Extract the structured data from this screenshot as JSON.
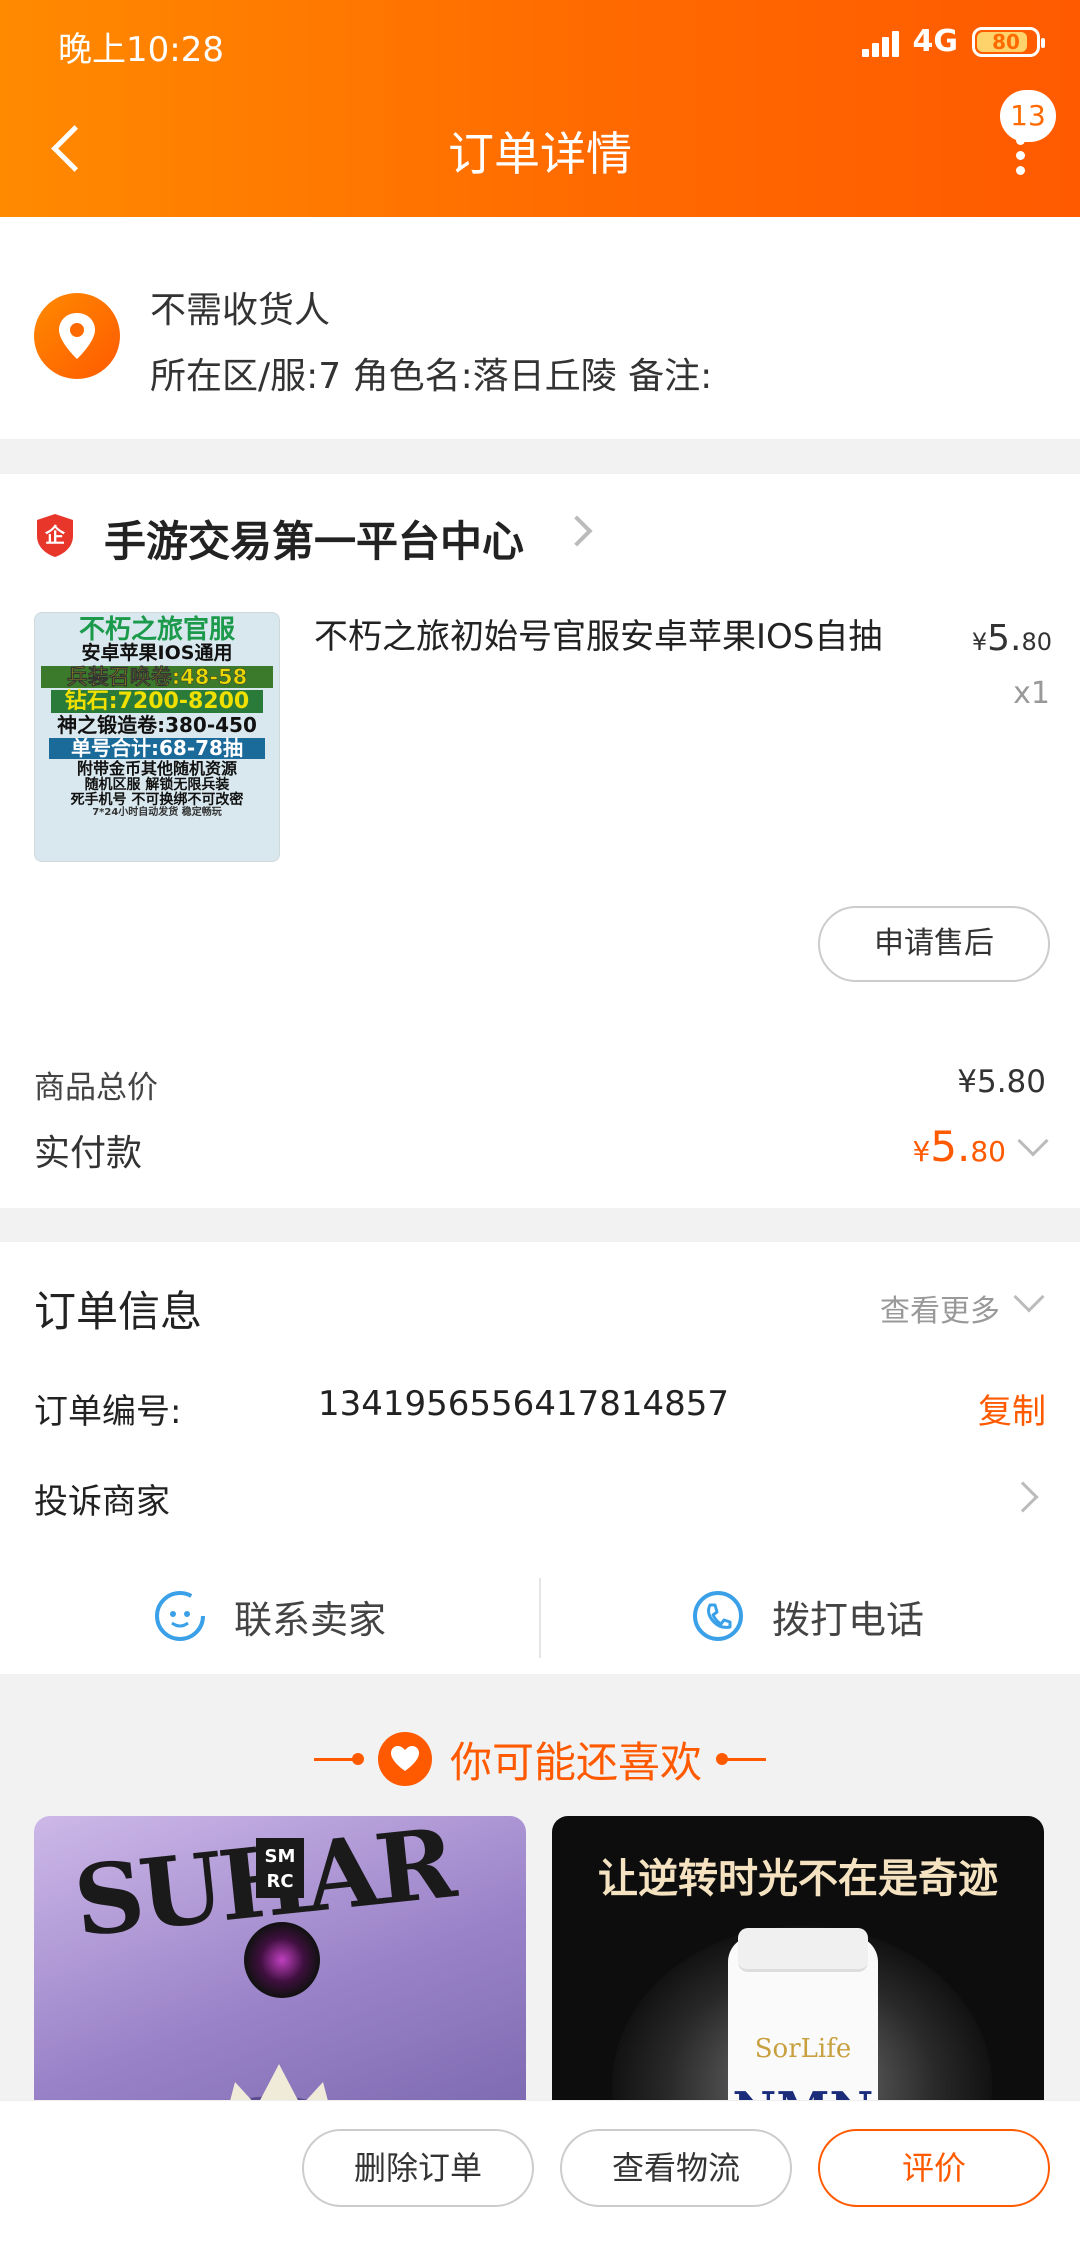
{
  "status_bar": {
    "time": "晚上10:28",
    "network": "4G",
    "battery": "80"
  },
  "nav": {
    "title": "订单详情",
    "badge_count": "13"
  },
  "address": {
    "line1": "不需收货人",
    "line2": "所在区/服:7 角色名:落日丘陵 备注:"
  },
  "shop": {
    "name": "手游交易第一平台中心",
    "product": {
      "title": "不朽之旅初始号官服安卓苹果IOS自抽",
      "price_symbol": "¥",
      "price_int": "5.",
      "price_dec": "80",
      "qty": "x1",
      "image_lines": [
        "不朽之旅官服",
        "安卓苹果IOS通用",
        "兵装召唤卷:48-58",
        "钻石:7200-8200",
        "神之锻造卷:380-450",
        "单号合计:68-78抽",
        "附带金币其他随机资源",
        "随机区服 解锁无限兵装",
        "死手机号 不可换绑不可改密",
        "7*24小时自动发货 稳定畅玩"
      ]
    },
    "after_sale_label": "申请售后",
    "total_label": "商品总价",
    "total_value": "¥5.80",
    "pay_label": "实付款",
    "pay_symbol": "¥",
    "pay_int": "5.",
    "pay_dec": "80"
  },
  "order_info": {
    "title": "订单信息",
    "more_label": "查看更多",
    "number_label": "订单编号:",
    "number_value": "1341956556417814857",
    "copy_label": "复制",
    "complain_label": "投诉商家",
    "contact_seller": "联系卖家",
    "call_phone": "拨打电话"
  },
  "recommend": {
    "title": "你可能还喜欢",
    "card_a": {
      "big_text": "SUHAR",
      "logo_text": "SM RC"
    },
    "card_b": {
      "headline": "让逆转时光不在是奇迹",
      "brand": "SorLife",
      "product": "NMN"
    }
  },
  "bottom_bar": {
    "delete_label": "删除订单",
    "logistics_label": "查看物流",
    "rate_label": "评价"
  },
  "colors": {
    "accent": "#ff5a00",
    "header_start": "#ff8a00"
  }
}
